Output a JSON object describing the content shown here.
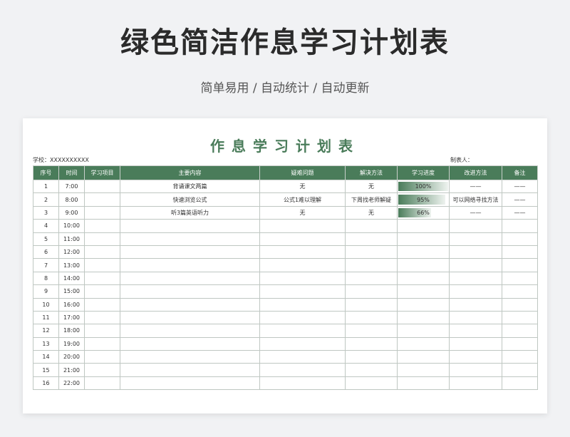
{
  "page": {
    "title": "绿色简洁作息学习计划表",
    "subtitle": "简单易用 / 自动统计 / 自动更新"
  },
  "sheet": {
    "title": "作息学习计划表",
    "school_label": "学校：XXXXXXXXXX",
    "maker_label": "制表人："
  },
  "table": {
    "headers": [
      "序号",
      "时间",
      "学习项目",
      "主要内容",
      "疑难问题",
      "解决方法",
      "学习进度",
      "改进方法",
      "备注"
    ],
    "rows": [
      {
        "no": "1",
        "time": "7:00",
        "item": "",
        "content": "背诵课文两篇",
        "problem": "无",
        "solution": "无",
        "progress": 1.0,
        "progress_label": "100%",
        "improve": "——",
        "note": "——"
      },
      {
        "no": "2",
        "time": "8:00",
        "item": "",
        "content": "快速浏览公式",
        "problem": "公式1难以理解",
        "solution": "下周找老师解疑",
        "progress": 0.95,
        "progress_label": "95%",
        "improve": "可以网络寻找方法",
        "note": "——"
      },
      {
        "no": "3",
        "time": "9:00",
        "item": "",
        "content": "听3篇英语听力",
        "problem": "无",
        "solution": "无",
        "progress": 0.66,
        "progress_label": "66%",
        "improve": "——",
        "note": "——"
      },
      {
        "no": "4",
        "time": "10:00",
        "item": "",
        "content": "",
        "problem": "",
        "solution": "",
        "progress": null,
        "progress_label": "",
        "improve": "",
        "note": ""
      },
      {
        "no": "5",
        "time": "11:00",
        "item": "",
        "content": "",
        "problem": "",
        "solution": "",
        "progress": null,
        "progress_label": "",
        "improve": "",
        "note": ""
      },
      {
        "no": "6",
        "time": "12:00",
        "item": "",
        "content": "",
        "problem": "",
        "solution": "",
        "progress": null,
        "progress_label": "",
        "improve": "",
        "note": ""
      },
      {
        "no": "7",
        "time": "13:00",
        "item": "",
        "content": "",
        "problem": "",
        "solution": "",
        "progress": null,
        "progress_label": "",
        "improve": "",
        "note": ""
      },
      {
        "no": "8",
        "time": "14:00",
        "item": "",
        "content": "",
        "problem": "",
        "solution": "",
        "progress": null,
        "progress_label": "",
        "improve": "",
        "note": ""
      },
      {
        "no": "9",
        "time": "15:00",
        "item": "",
        "content": "",
        "problem": "",
        "solution": "",
        "progress": null,
        "progress_label": "",
        "improve": "",
        "note": ""
      },
      {
        "no": "10",
        "time": "16:00",
        "item": "",
        "content": "",
        "problem": "",
        "solution": "",
        "progress": null,
        "progress_label": "",
        "improve": "",
        "note": ""
      },
      {
        "no": "11",
        "time": "17:00",
        "item": "",
        "content": "",
        "problem": "",
        "solution": "",
        "progress": null,
        "progress_label": "",
        "improve": "",
        "note": ""
      },
      {
        "no": "12",
        "time": "18:00",
        "item": "",
        "content": "",
        "problem": "",
        "solution": "",
        "progress": null,
        "progress_label": "",
        "improve": "",
        "note": ""
      },
      {
        "no": "13",
        "time": "19:00",
        "item": "",
        "content": "",
        "problem": "",
        "solution": "",
        "progress": null,
        "progress_label": "",
        "improve": "",
        "note": ""
      },
      {
        "no": "14",
        "time": "20:00",
        "item": "",
        "content": "",
        "problem": "",
        "solution": "",
        "progress": null,
        "progress_label": "",
        "improve": "",
        "note": ""
      },
      {
        "no": "15",
        "time": "21:00",
        "item": "",
        "content": "",
        "problem": "",
        "solution": "",
        "progress": null,
        "progress_label": "",
        "improve": "",
        "note": ""
      },
      {
        "no": "16",
        "time": "22:00",
        "item": "",
        "content": "",
        "problem": "",
        "solution": "",
        "progress": null,
        "progress_label": "",
        "improve": "",
        "note": ""
      }
    ]
  },
  "colors": {
    "header_green": "#4a7c5a",
    "title_green": "#4a7c5a",
    "page_background": "#f1f2f4"
  }
}
